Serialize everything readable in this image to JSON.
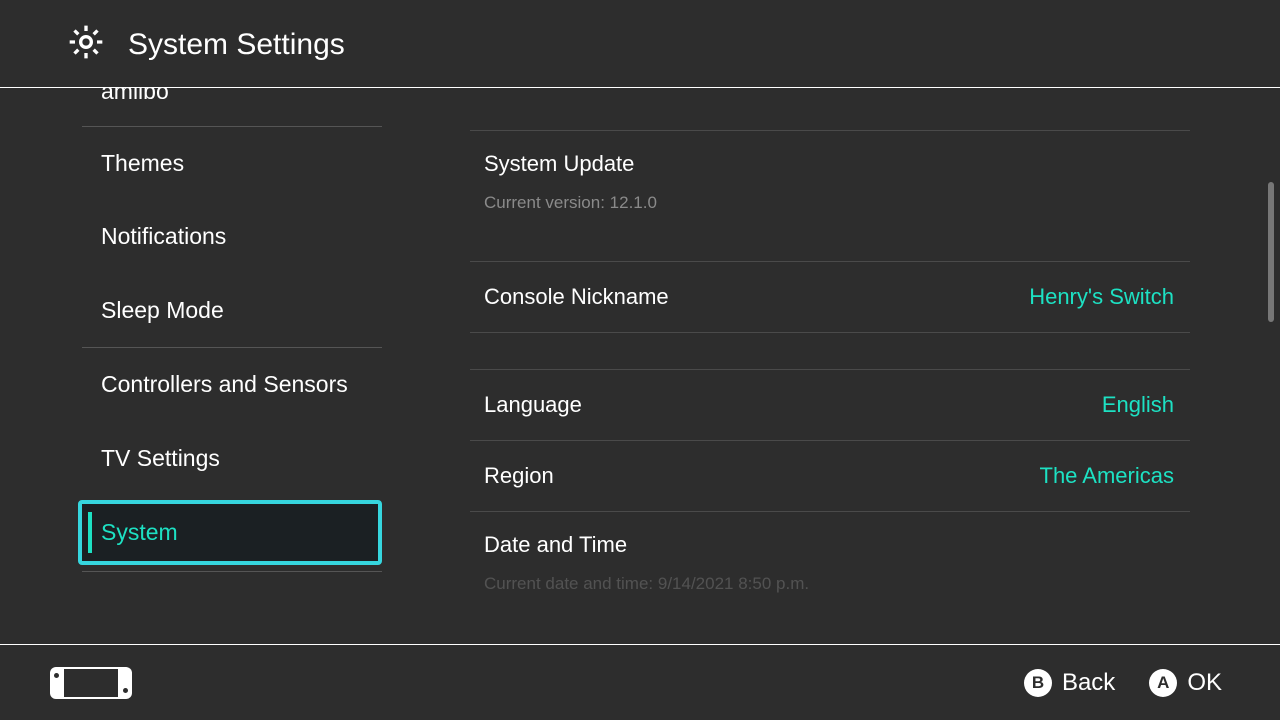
{
  "header": {
    "title": "System Settings"
  },
  "sidebar": {
    "items": [
      {
        "label": "amiibo"
      },
      {
        "label": "Themes"
      },
      {
        "label": "Notifications"
      },
      {
        "label": "Sleep Mode"
      },
      {
        "label": "Controllers and Sensors"
      },
      {
        "label": "TV Settings"
      },
      {
        "label": "System"
      }
    ]
  },
  "content": {
    "system_update": {
      "label": "System Update",
      "version_label": "Current version: 12.1.0"
    },
    "console_nickname": {
      "label": "Console Nickname",
      "value": "Henry's Switch"
    },
    "language": {
      "label": "Language",
      "value": "English"
    },
    "region": {
      "label": "Region",
      "value": "The Americas"
    },
    "date_time": {
      "label": "Date and Time",
      "subtext": "Current date and time: 9/14/2021 8:50 p.m."
    }
  },
  "footer": {
    "back_label": "Back",
    "ok_label": "OK",
    "back_button": "B",
    "ok_button": "A"
  },
  "colors": {
    "accent": "#1de1c3",
    "highlight_border": "#36d6de",
    "bg": "#2d2d2d"
  }
}
